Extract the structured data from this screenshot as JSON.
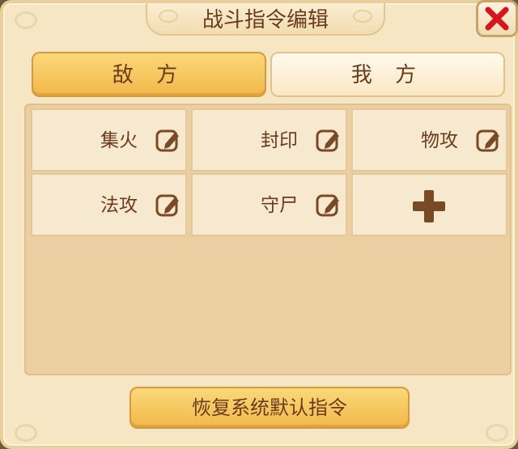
{
  "dialog": {
    "title": "战斗指令编辑",
    "close_icon": "close-x-icon"
  },
  "tabs": [
    {
      "label": "敌 方",
      "active": true
    },
    {
      "label": "我 方",
      "active": false
    }
  ],
  "commands": [
    {
      "label": "集火",
      "icon": "edit-icon"
    },
    {
      "label": "封印",
      "icon": "edit-icon"
    },
    {
      "label": "物攻",
      "icon": "edit-icon"
    },
    {
      "label": "法攻",
      "icon": "edit-icon"
    },
    {
      "label": "守尸",
      "icon": "edit-icon"
    }
  ],
  "add_command": {
    "icon": "plus-icon"
  },
  "restore_button": {
    "label": "恢复系统默认指令"
  },
  "colors": {
    "panel": "#f6e6c4",
    "tab_active": "#f2b84a",
    "text": "#6a3c1d",
    "close_x": "#d4171c",
    "icon": "#7a4a24"
  }
}
